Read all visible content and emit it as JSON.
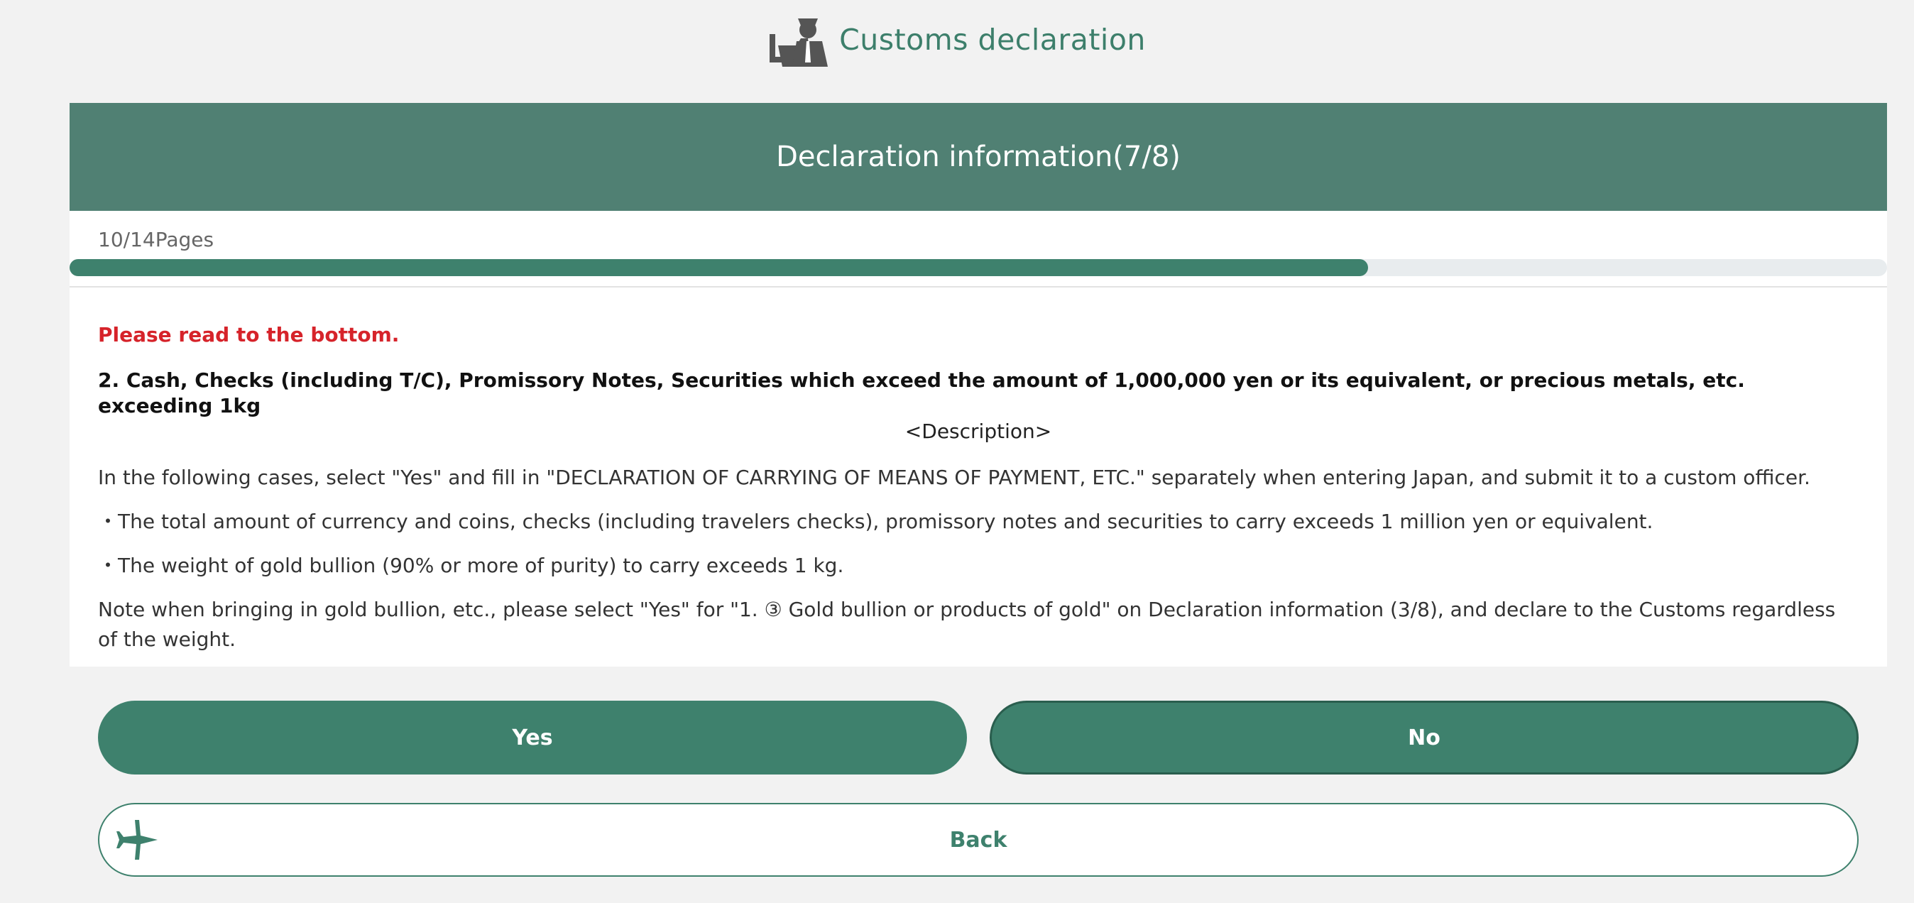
{
  "app": {
    "title": "Customs declaration",
    "icon": "customs-officer-icon"
  },
  "header": {
    "title": "Declaration information(7/8)"
  },
  "progress": {
    "label": "10/14Pages",
    "current": 10,
    "total": 14
  },
  "content": {
    "warning": "Please read to the bottom.",
    "heading": "2. Cash, Checks (including T/C), Promissory Notes, Securities which exceed the amount of 1,000,000 yen or its equivalent, or precious metals, etc. exceeding 1kg",
    "description_label": "<Description>",
    "intro": "In the following cases, select \"Yes\" and fill in \"DECLARATION OF CARRYING OF MEANS OF PAYMENT, ETC.\" separately when entering Japan, and submit it to a custom officer.",
    "bullet1": "・The total amount of currency and coins, checks (including travelers checks), promissory notes and securities to carry exceeds 1 million yen or equivalent.",
    "bullet2": "・The weight of gold bullion (90% or more of purity) to carry exceeds 1 kg.",
    "note": "Note when bringing in gold bullion, etc., please select \"Yes\" for \"1. ③ Gold bullion or products of gold\" on Declaration information (3/8), and declare to the Customs regardless of the weight."
  },
  "buttons": {
    "yes": "Yes",
    "no": "No",
    "back": "Back",
    "back_icon": "airplane-icon"
  },
  "colors": {
    "accent": "#3e816d",
    "header": "#508073",
    "warning": "#d6232a"
  }
}
